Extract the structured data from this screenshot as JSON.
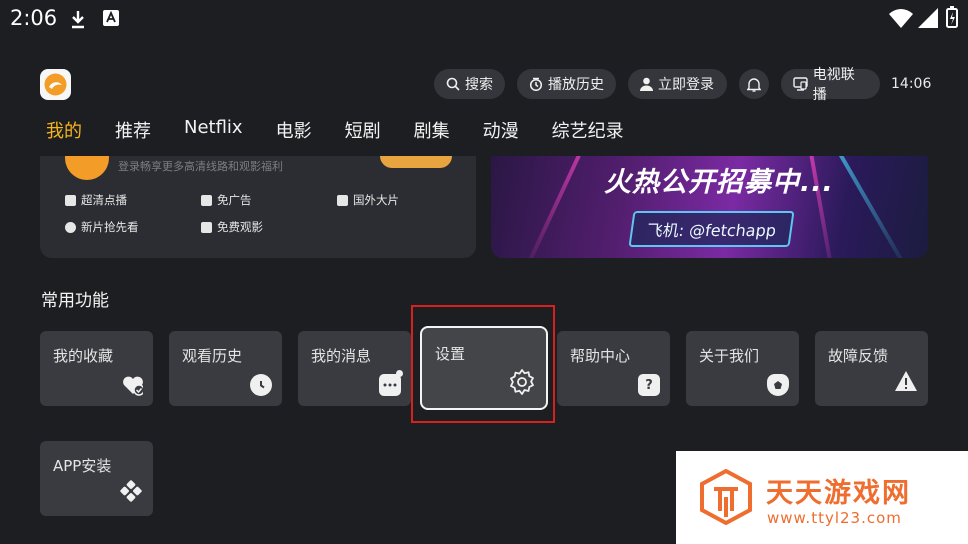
{
  "status_bar": {
    "time": "2:06"
  },
  "top_bar": {
    "search_label": "搜索",
    "history_label": "播放历史",
    "login_label": "立即登录",
    "tv_label": "电视联播",
    "clock": "14:06"
  },
  "nav": {
    "tabs": [
      "我的",
      "推荐",
      "Netflix",
      "电影",
      "短剧",
      "剧集",
      "动漫",
      "综艺纪录"
    ],
    "active_index": 0
  },
  "member_card": {
    "subtitle": "登录畅享更多高清线路和观影福利",
    "features": [
      "超清点播",
      "免广告",
      "国外大片",
      "新片抢先看",
      "免费观影"
    ]
  },
  "banner": {
    "title": "火热公开招募中...",
    "tag": "飞机: @fetchapp"
  },
  "common_functions": {
    "title": "常用功能",
    "tiles": [
      {
        "label": "我的收藏",
        "icon": "heart-check-icon"
      },
      {
        "label": "观看历史",
        "icon": "clock-icon"
      },
      {
        "label": "我的消息",
        "icon": "message-icon"
      },
      {
        "label": "设置",
        "icon": "gear-icon"
      },
      {
        "label": "帮助中心",
        "icon": "help-icon"
      },
      {
        "label": "关于我们",
        "icon": "about-icon"
      },
      {
        "label": "故障反馈",
        "icon": "warning-icon"
      },
      {
        "label": "APP安装",
        "icon": "app-install-icon"
      }
    ]
  },
  "watermark": {
    "title": "天天游戏网",
    "url": "www.ttyl23.com"
  },
  "colors": {
    "accent": "#f6b41b",
    "background": "#1d1e22",
    "tile": "#3a3b40",
    "highlight_box": "#d8201f",
    "watermark": "#ee6d2f"
  }
}
